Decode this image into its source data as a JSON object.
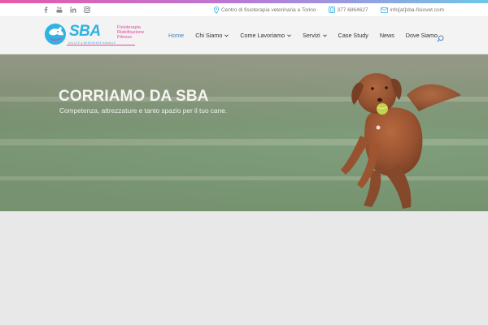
{
  "topbar": {
    "social": [
      {
        "icon": "facebook-icon"
      },
      {
        "icon": "youtube-icon"
      },
      {
        "icon": "linkedin-icon"
      },
      {
        "icon": "instagram-icon"
      }
    ],
    "address": "Centro di fisioterapia veterinaria a Torino",
    "phone": "377 6864627",
    "email": "info[at]sba-fisiovet.com"
  },
  "logo": {
    "name": "SBA",
    "tagline": [
      "Fisioterapia",
      "Riabilitazione",
      "Fitness"
    ],
    "subtitle": "SALUTE & BENESSERE ANIMALE"
  },
  "nav": {
    "items": [
      {
        "label": "Home",
        "active": true,
        "dropdown": false
      },
      {
        "label": "Chi Siamo",
        "active": false,
        "dropdown": true
      },
      {
        "label": "Come Lavoriamo",
        "active": false,
        "dropdown": true
      },
      {
        "label": "Servizi",
        "active": false,
        "dropdown": true
      },
      {
        "label": "Case Study",
        "active": false,
        "dropdown": false
      },
      {
        "label": "News",
        "active": false,
        "dropdown": false
      },
      {
        "label": "Dove Siamo",
        "active": false,
        "dropdown": false
      }
    ],
    "search_icon": "search-icon"
  },
  "hero": {
    "title": "CORRIAMO DA SBA",
    "subtitle": "Competenza, attrezzature e tanto spazio per il tuo cane."
  },
  "colors": {
    "accent_blue": "#2fb3e3",
    "accent_pink": "#e0479b",
    "nav_active": "#4a84bf"
  }
}
